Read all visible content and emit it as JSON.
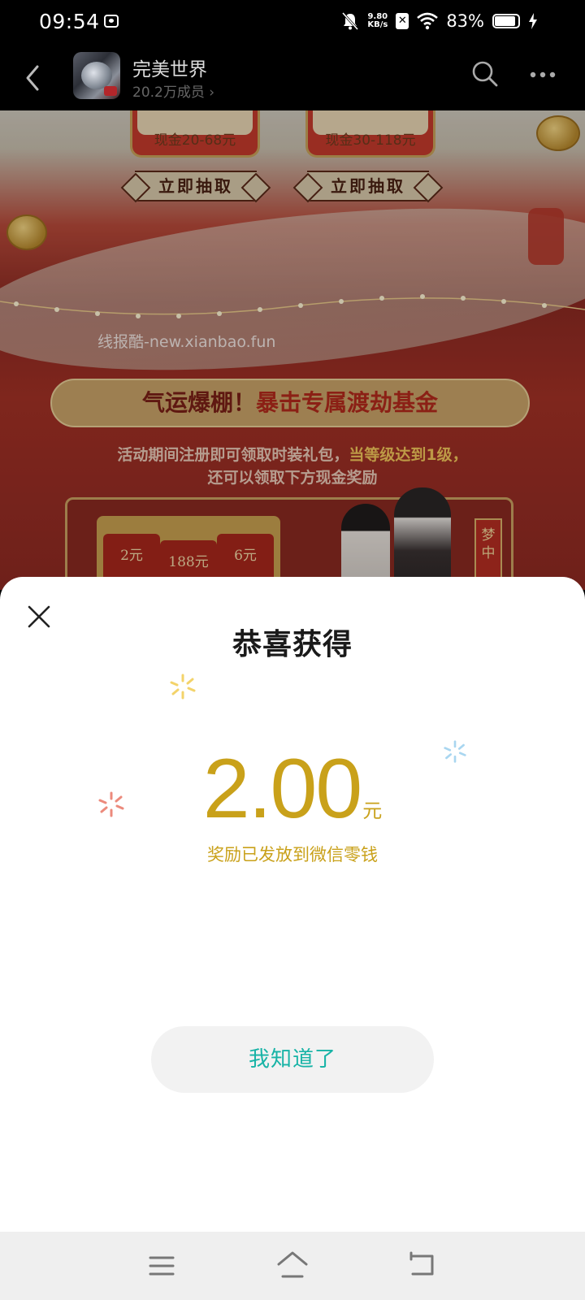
{
  "status_bar": {
    "time": "09:54",
    "net_speed_value": "9.80",
    "net_speed_unit": "KB/s",
    "battery_percent": "83%",
    "battery_level": 0.83
  },
  "header": {
    "group_name": "完美世界",
    "member_count": "20.2万成员 ›"
  },
  "banner": {
    "card_left_text": "现金20-68元",
    "card_right_text": "现金30-118元",
    "draw_button_left": "立即抽取",
    "draw_button_right": "立即抽取",
    "watermark": "线报酷-new.xianbao.fun",
    "fund_title_part1": "气运爆棚！",
    "fund_title_part2": "暴击专属渡劫基金",
    "fund_desc_line1_a": "活动期间注册即可领取时装礼包，",
    "fund_desc_line1_b": "当等级达到1级，",
    "fund_desc_line2": "还可以领取下方现金奖励",
    "envelope_1": "2元",
    "envelope_2": "188元",
    "envelope_3": "6元",
    "side_tag": "梦中"
  },
  "sheet": {
    "title": "恭喜获得",
    "amount": "2.00",
    "amount_unit": "元",
    "note": "奖励已发放到微信零钱",
    "ok_button": "我知道了"
  },
  "colors": {
    "amount_gold": "#c9a11a",
    "button_teal": "#17b3a6",
    "sparkle_yellow": "#f3d36a",
    "sparkle_red": "#ec8a7c",
    "sparkle_blue": "#a9d6f0"
  },
  "icons": [
    "bell-muted-icon",
    "x-app-icon",
    "wifi-icon",
    "battery-icon",
    "charging-icon",
    "back-icon",
    "search-icon",
    "more-icon",
    "close-icon",
    "sparkle-icon",
    "nav-menu-icon",
    "nav-home-icon",
    "nav-back-icon"
  ]
}
